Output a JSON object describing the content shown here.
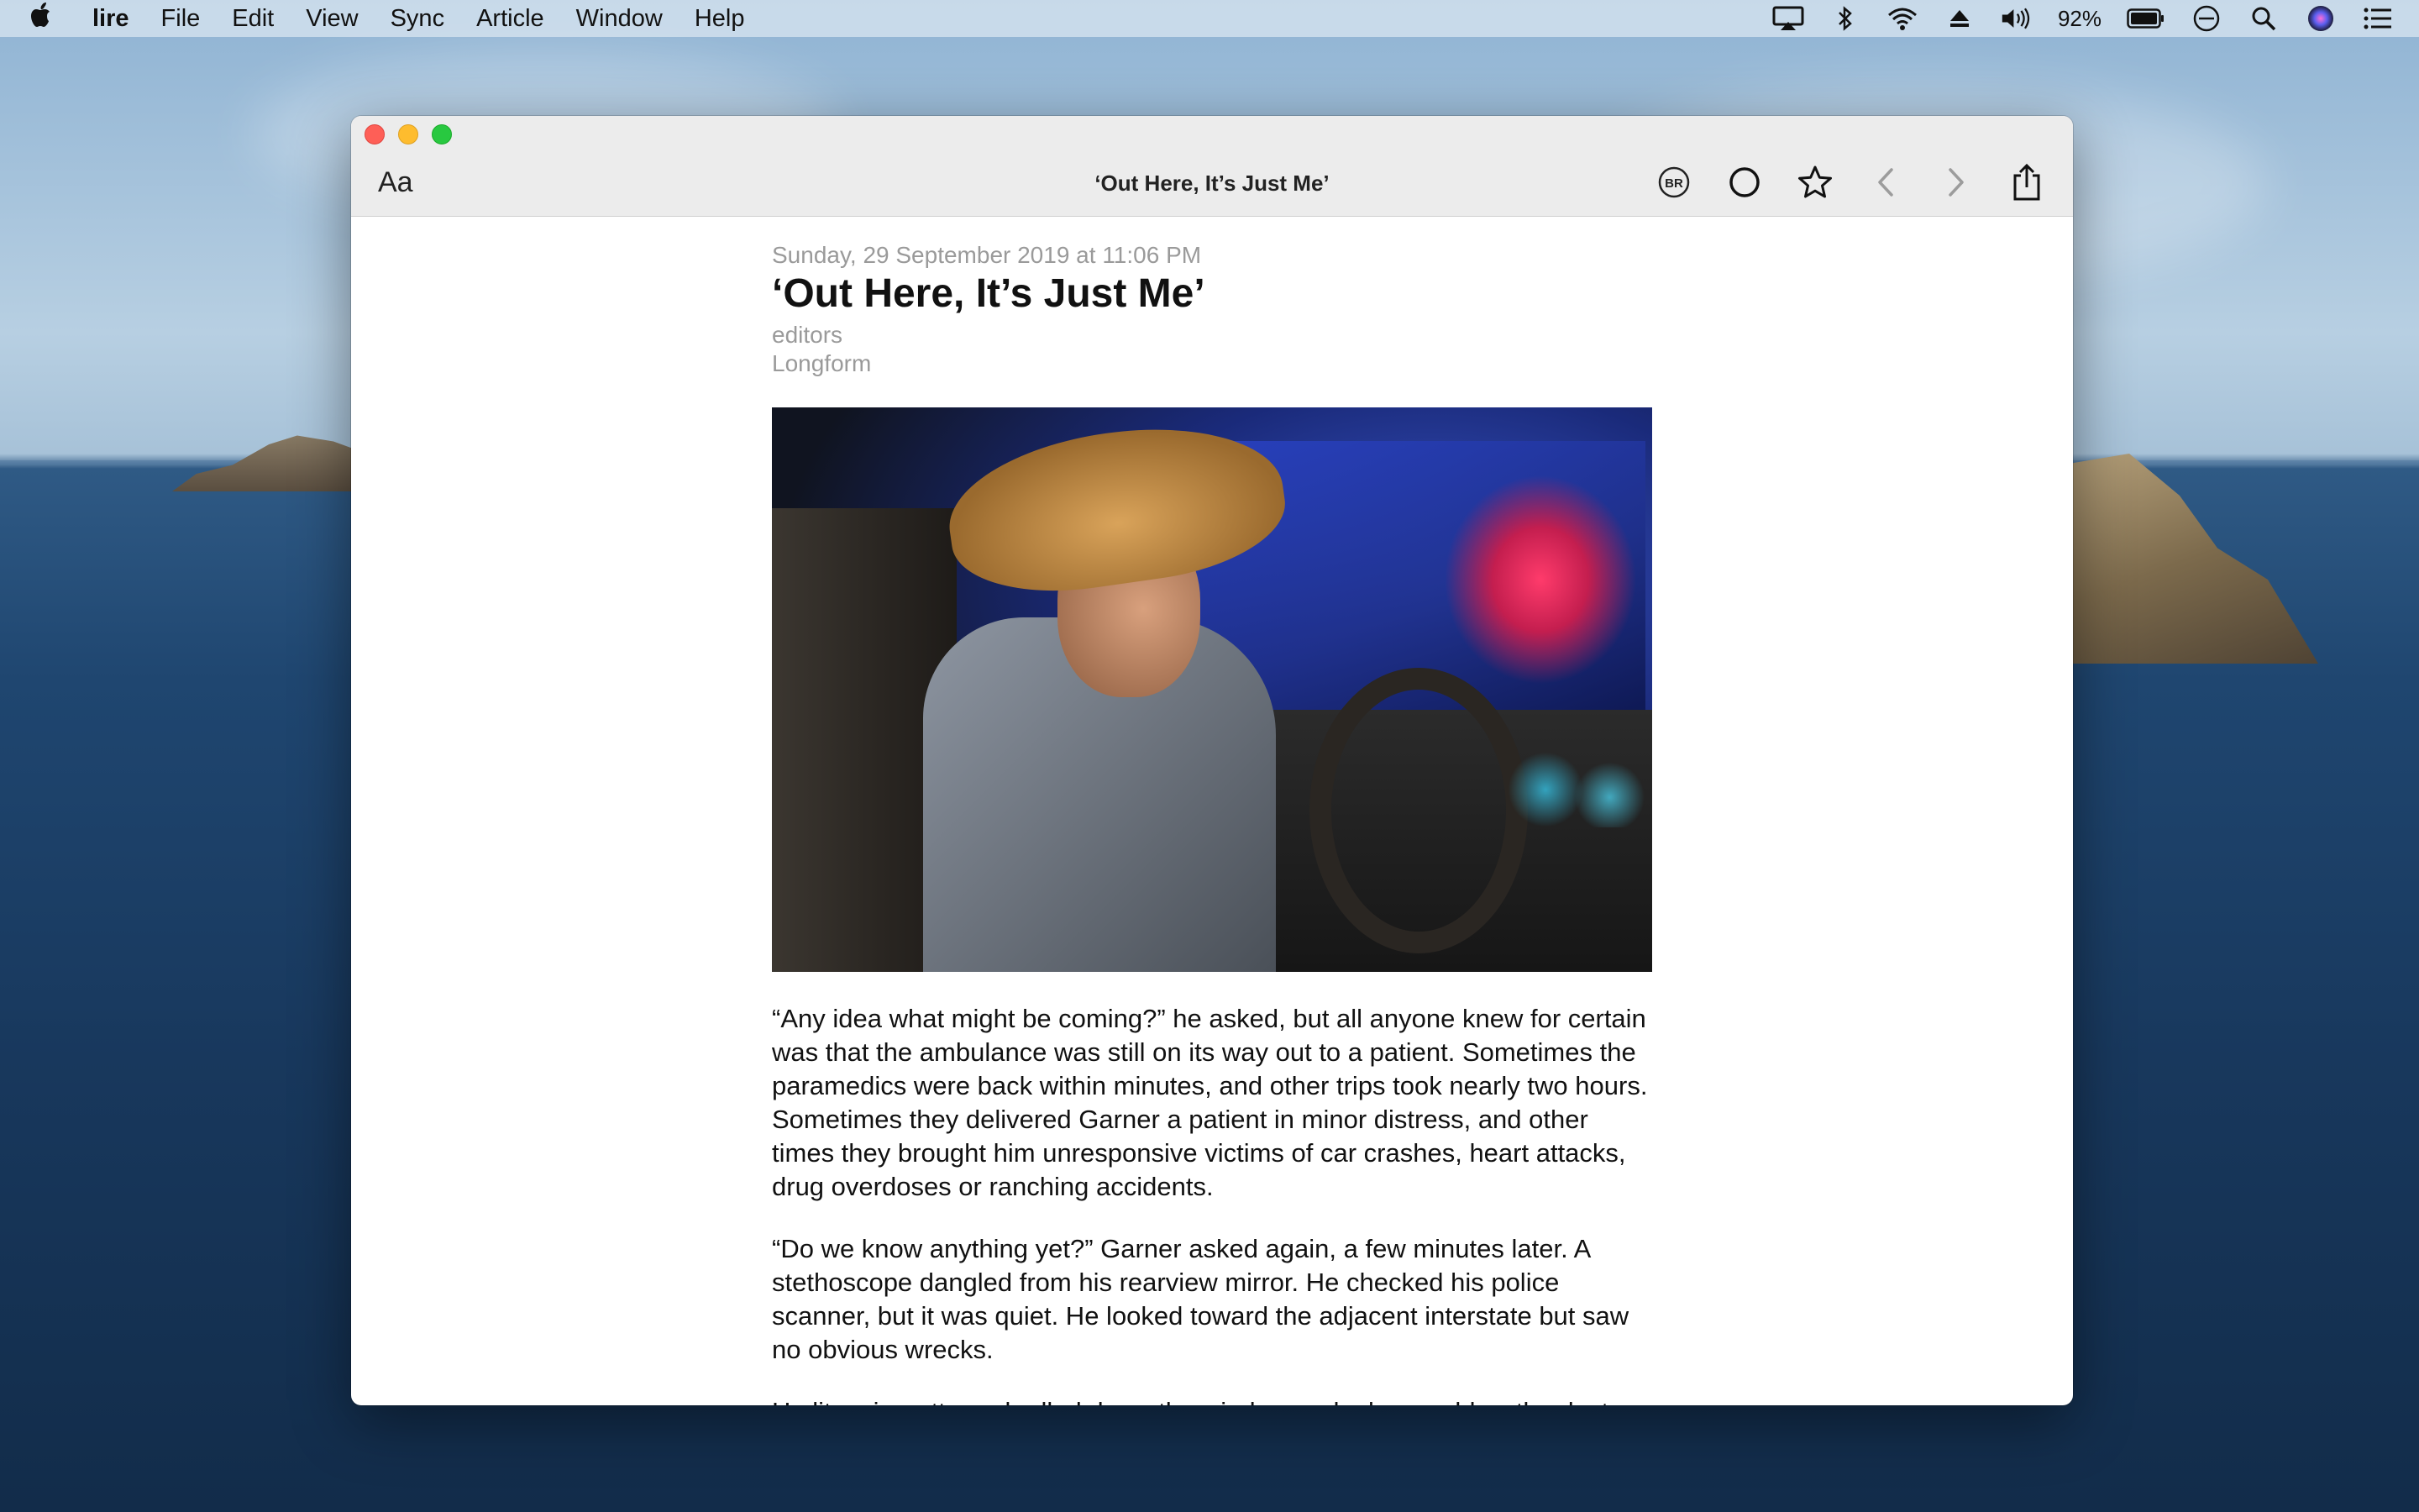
{
  "menubar": {
    "app_name": "lire",
    "items": [
      "File",
      "Edit",
      "View",
      "Sync",
      "Article",
      "Window",
      "Help"
    ],
    "battery": "92%"
  },
  "window": {
    "title": "‘Out Here, It’s Just Me’",
    "font_button": "Aa",
    "toolbar": {
      "br_label": "BR"
    }
  },
  "article": {
    "date": "Sunday, 29 September 2019 at 11:06 PM",
    "title": "‘Out Here, It’s Just Me’",
    "author": "editors",
    "source": "Longform",
    "paragraphs": [
      "“Any idea what might be coming?” he asked, but all anyone knew for certain was that the ambulance was still on its way out to a patient. Sometimes the paramedics were back within minutes, and other trips took nearly two hours. Sometimes they delivered Garner a patient in minor distress, and other times they brought him unresponsive victims of car crashes, heart attacks, drug overdoses or ranching accidents.",
      "“Do we know anything yet?” Garner asked again, a few minutes later. A stethoscope dangled from his rearview mirror. He checked his police scanner, but it was quiet. He looked toward the adjacent interstate but saw no obvious wrecks.",
      "He lit a cigarette and rolled down the window and a breeze blew the dust"
    ]
  }
}
